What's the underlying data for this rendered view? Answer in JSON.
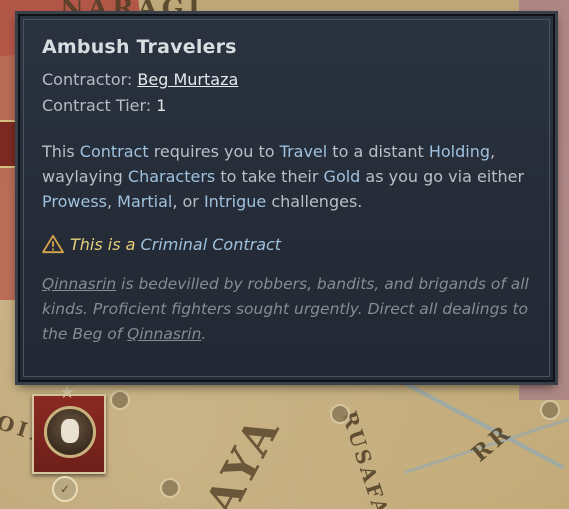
{
  "map": {
    "labels": {
      "top": "NARAGI",
      "left": "OIN",
      "big": "AYA",
      "rusafa": "RUSAFA",
      "rr": "RR"
    }
  },
  "tooltip": {
    "title": "Ambush Travelers",
    "contractor_label": "Contractor:",
    "contractor_name": "Beg Murtaza",
    "tier_label": "Contract Tier:",
    "tier_value": "1",
    "description": {
      "p1": "This ",
      "contract": "Contract",
      "p2": " requires you to ",
      "travel": "Travel",
      "p3": " to a distant ",
      "holding": "Holding",
      "p4": ",",
      "p5": "waylaying ",
      "characters": "Characters",
      "p6": " to take their ",
      "gold": "Gold",
      "p7": " as you go via either",
      "prowess": "Prowess",
      "p8": ", ",
      "martial": "Martial",
      "p9": ", or ",
      "intrigue": "Intrigue",
      "p10": " challenges."
    },
    "criminal_prefix": "This is a ",
    "criminal_link": "Criminal Contract",
    "flavor": {
      "place1": "Qinnasrin",
      "t1": " is bedevilled by robbers, bandits, and brigands of all kinds. Proficient fighters sought urgently. Direct all dealings to the Beg of ",
      "place2": "Qinnasrin",
      "t2": "."
    }
  },
  "colors": {
    "highlight": "#9fc1de",
    "criminal": "#e5cf7a",
    "tooltip_bg": "#262d39"
  },
  "icons": {
    "warning": "warning-triangle-icon",
    "star": "star-icon",
    "badge": "check-badge-icon"
  }
}
